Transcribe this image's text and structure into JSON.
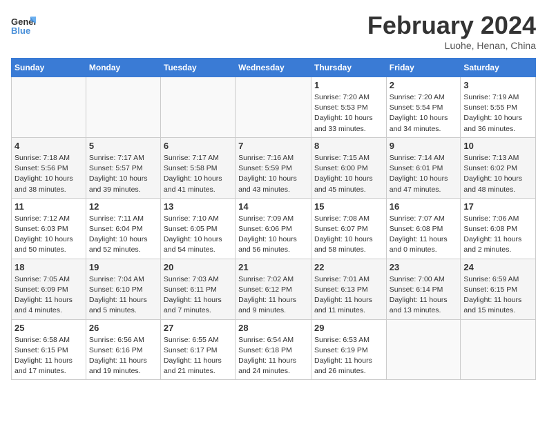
{
  "logo": {
    "text_general": "General",
    "text_blue": "Blue"
  },
  "header": {
    "title": "February 2024",
    "subtitle": "Luohe, Henan, China"
  },
  "days_of_week": [
    "Sunday",
    "Monday",
    "Tuesday",
    "Wednesday",
    "Thursday",
    "Friday",
    "Saturday"
  ],
  "weeks": [
    {
      "alt": false,
      "days": [
        {
          "num": "",
          "info": ""
        },
        {
          "num": "",
          "info": ""
        },
        {
          "num": "",
          "info": ""
        },
        {
          "num": "",
          "info": ""
        },
        {
          "num": "1",
          "info": "Sunrise: 7:20 AM\nSunset: 5:53 PM\nDaylight: 10 hours\nand 33 minutes."
        },
        {
          "num": "2",
          "info": "Sunrise: 7:20 AM\nSunset: 5:54 PM\nDaylight: 10 hours\nand 34 minutes."
        },
        {
          "num": "3",
          "info": "Sunrise: 7:19 AM\nSunset: 5:55 PM\nDaylight: 10 hours\nand 36 minutes."
        }
      ]
    },
    {
      "alt": true,
      "days": [
        {
          "num": "4",
          "info": "Sunrise: 7:18 AM\nSunset: 5:56 PM\nDaylight: 10 hours\nand 38 minutes."
        },
        {
          "num": "5",
          "info": "Sunrise: 7:17 AM\nSunset: 5:57 PM\nDaylight: 10 hours\nand 39 minutes."
        },
        {
          "num": "6",
          "info": "Sunrise: 7:17 AM\nSunset: 5:58 PM\nDaylight: 10 hours\nand 41 minutes."
        },
        {
          "num": "7",
          "info": "Sunrise: 7:16 AM\nSunset: 5:59 PM\nDaylight: 10 hours\nand 43 minutes."
        },
        {
          "num": "8",
          "info": "Sunrise: 7:15 AM\nSunset: 6:00 PM\nDaylight: 10 hours\nand 45 minutes."
        },
        {
          "num": "9",
          "info": "Sunrise: 7:14 AM\nSunset: 6:01 PM\nDaylight: 10 hours\nand 47 minutes."
        },
        {
          "num": "10",
          "info": "Sunrise: 7:13 AM\nSunset: 6:02 PM\nDaylight: 10 hours\nand 48 minutes."
        }
      ]
    },
    {
      "alt": false,
      "days": [
        {
          "num": "11",
          "info": "Sunrise: 7:12 AM\nSunset: 6:03 PM\nDaylight: 10 hours\nand 50 minutes."
        },
        {
          "num": "12",
          "info": "Sunrise: 7:11 AM\nSunset: 6:04 PM\nDaylight: 10 hours\nand 52 minutes."
        },
        {
          "num": "13",
          "info": "Sunrise: 7:10 AM\nSunset: 6:05 PM\nDaylight: 10 hours\nand 54 minutes."
        },
        {
          "num": "14",
          "info": "Sunrise: 7:09 AM\nSunset: 6:06 PM\nDaylight: 10 hours\nand 56 minutes."
        },
        {
          "num": "15",
          "info": "Sunrise: 7:08 AM\nSunset: 6:07 PM\nDaylight: 10 hours\nand 58 minutes."
        },
        {
          "num": "16",
          "info": "Sunrise: 7:07 AM\nSunset: 6:08 PM\nDaylight: 11 hours\nand 0 minutes."
        },
        {
          "num": "17",
          "info": "Sunrise: 7:06 AM\nSunset: 6:08 PM\nDaylight: 11 hours\nand 2 minutes."
        }
      ]
    },
    {
      "alt": true,
      "days": [
        {
          "num": "18",
          "info": "Sunrise: 7:05 AM\nSunset: 6:09 PM\nDaylight: 11 hours\nand 4 minutes."
        },
        {
          "num": "19",
          "info": "Sunrise: 7:04 AM\nSunset: 6:10 PM\nDaylight: 11 hours\nand 5 minutes."
        },
        {
          "num": "20",
          "info": "Sunrise: 7:03 AM\nSunset: 6:11 PM\nDaylight: 11 hours\nand 7 minutes."
        },
        {
          "num": "21",
          "info": "Sunrise: 7:02 AM\nSunset: 6:12 PM\nDaylight: 11 hours\nand 9 minutes."
        },
        {
          "num": "22",
          "info": "Sunrise: 7:01 AM\nSunset: 6:13 PM\nDaylight: 11 hours\nand 11 minutes."
        },
        {
          "num": "23",
          "info": "Sunrise: 7:00 AM\nSunset: 6:14 PM\nDaylight: 11 hours\nand 13 minutes."
        },
        {
          "num": "24",
          "info": "Sunrise: 6:59 AM\nSunset: 6:15 PM\nDaylight: 11 hours\nand 15 minutes."
        }
      ]
    },
    {
      "alt": false,
      "days": [
        {
          "num": "25",
          "info": "Sunrise: 6:58 AM\nSunset: 6:15 PM\nDaylight: 11 hours\nand 17 minutes."
        },
        {
          "num": "26",
          "info": "Sunrise: 6:56 AM\nSunset: 6:16 PM\nDaylight: 11 hours\nand 19 minutes."
        },
        {
          "num": "27",
          "info": "Sunrise: 6:55 AM\nSunset: 6:17 PM\nDaylight: 11 hours\nand 21 minutes."
        },
        {
          "num": "28",
          "info": "Sunrise: 6:54 AM\nSunset: 6:18 PM\nDaylight: 11 hours\nand 24 minutes."
        },
        {
          "num": "29",
          "info": "Sunrise: 6:53 AM\nSunset: 6:19 PM\nDaylight: 11 hours\nand 26 minutes."
        },
        {
          "num": "",
          "info": ""
        },
        {
          "num": "",
          "info": ""
        }
      ]
    }
  ]
}
